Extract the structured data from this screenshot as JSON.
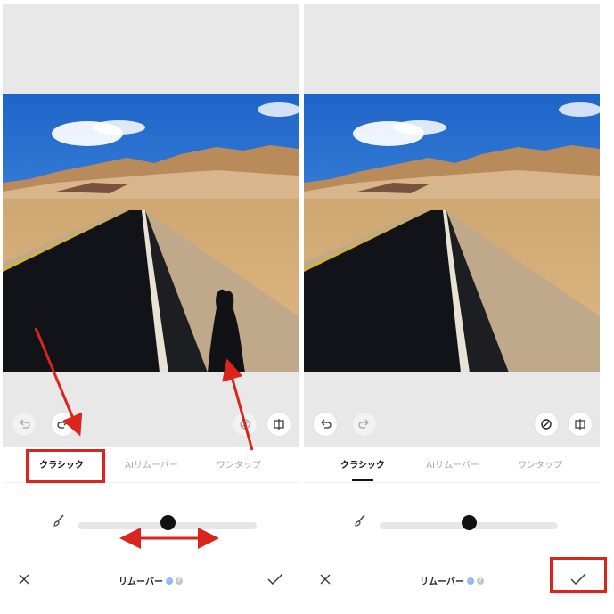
{
  "panels": [
    {
      "id": "before",
      "toolbar": {
        "undo_icon": "undo-icon",
        "redo_icon": "redo-icon",
        "eraser_icon": "eraser-icon",
        "compare_icon": "compare-icon"
      },
      "tabs": [
        {
          "label": "クラシック",
          "active": true
        },
        {
          "label": "AIリムーバー",
          "active": false
        },
        {
          "label": "ワンタップ",
          "active": false
        }
      ],
      "slider_value": 0.5,
      "bottom": {
        "title": "リムーバー",
        "cancel_icon": "close-icon",
        "confirm_icon": "checkmark-icon"
      }
    },
    {
      "id": "after",
      "toolbar": {
        "undo_icon": "undo-icon",
        "redo_icon": "redo-icon",
        "eraser_icon": "eraser-icon",
        "compare_icon": "compare-icon"
      },
      "tabs": [
        {
          "label": "クラシック",
          "active": true
        },
        {
          "label": "AIリムーバー",
          "active": false
        },
        {
          "label": "ワンタップ",
          "active": false
        }
      ],
      "slider_value": 0.5,
      "bottom": {
        "title": "リムーバー",
        "cancel_icon": "close-icon",
        "confirm_icon": "checkmark-icon"
      }
    }
  ],
  "annotation_color": "#d9251d"
}
